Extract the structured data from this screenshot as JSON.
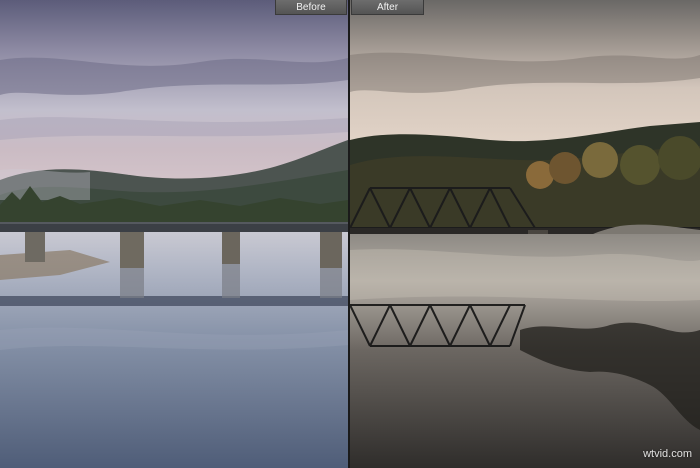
{
  "labels": {
    "before": "Before",
    "after": "After"
  },
  "watermark": "wtvid.com",
  "colors": {
    "before_sky_top": "#5f5f7e",
    "before_sky_mid": "#b9b6c7",
    "before_horizon": "#c7b7c0",
    "before_water": "#6f7f96",
    "after_sky_top": "#6f6f6f",
    "after_sky_mid": "#d4c8bd",
    "after_horizon": "#e2d3c6",
    "after_water": "#3d3b39",
    "divider": "#1a1a1a"
  }
}
